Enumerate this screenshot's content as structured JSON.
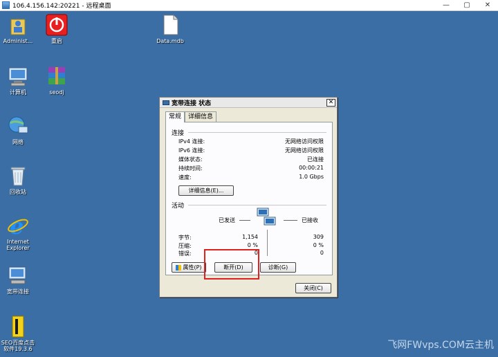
{
  "window": {
    "title": "106.4.156.142:20221 - 远程桌面",
    "controls": [
      "—",
      "▢",
      "✕"
    ]
  },
  "desktop": {
    "icons": [
      {
        "name": "administrator-folder-icon",
        "label": "Administ..."
      },
      {
        "name": "restart-icon",
        "label": "重启"
      },
      {
        "name": "data-mdb-file-icon",
        "label": "Data.mdb"
      },
      {
        "name": "computer-icon",
        "label": "计算机"
      },
      {
        "name": "seodj-rar-icon",
        "label": "seodj"
      },
      {
        "name": "network-icon",
        "label": "网络"
      },
      {
        "name": "recycle-bin-icon",
        "label": "回收站"
      },
      {
        "name": "internet-explorer-icon",
        "label": "Internet\nExplorer"
      },
      {
        "name": "broadband-connection-icon",
        "label": "宽带连接"
      },
      {
        "name": "seo-baidu-clicker-icon",
        "label": "SEO百度点击\n软件19.3.6"
      }
    ],
    "watermark": "飞网FWvps.COM云主机"
  },
  "dialog": {
    "title": "宽带连接 状态",
    "close": "✕",
    "tabs": [
      "常规",
      "详细信息"
    ],
    "connection_header": "连接",
    "rows": [
      {
        "label": "IPv4 连接:",
        "value": "无网络访问权限"
      },
      {
        "label": "IPv6 连接:",
        "value": "无网络访问权限"
      },
      {
        "label": "媒体状态:",
        "value": "已连接"
      },
      {
        "label": "持续时间:",
        "value": "00:00:21"
      },
      {
        "label": "速度:",
        "value": "1.0 Gbps"
      }
    ],
    "details_button": "详细信息(E)...",
    "activity_header": "活动",
    "sent_label": "已发送",
    "received_label": "已接收",
    "stats": [
      {
        "label": "字节:",
        "sent": "1,154",
        "received": "309"
      },
      {
        "label": "压缩:",
        "sent": "0 %",
        "received": "0 %"
      },
      {
        "label": "错误:",
        "sent": "0",
        "received": "0"
      }
    ],
    "properties_button": "属性(P)",
    "disconnect_button": "断开(D)",
    "diagnose_button": "诊断(G)",
    "close_button": "关闭(C)"
  },
  "colors": {
    "desktop": "#3a6ea5",
    "highlight": "#e02020"
  }
}
